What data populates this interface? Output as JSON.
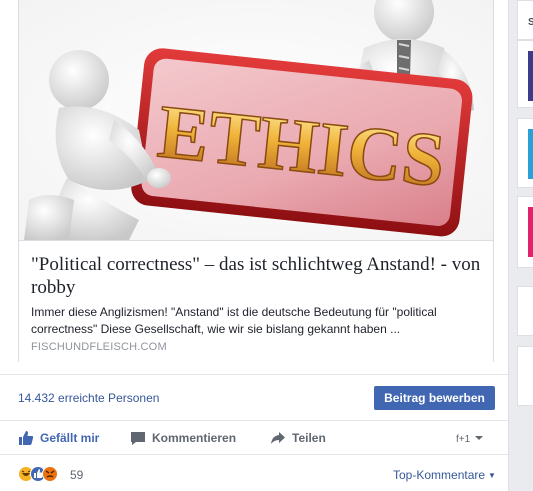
{
  "link": {
    "title": "\"Political correctness\" – das ist schlichtweg Anstand! - von robby",
    "description": "Immer diese Anglizismen! \"Anstand\" ist die deutsche Bedeutung für \"political correctness\" Diese Gesellschaft, wie wir sie bislang gekannt haben ...",
    "domain": "FISCHUNDFLEISCH.COM",
    "image_text": "ETHICS"
  },
  "insights": {
    "reach": "14.432 erreichte Personen",
    "boost_label": "Beitrag bewerben"
  },
  "actions": {
    "like": "Gefällt mir",
    "comment": "Kommentieren",
    "share": "Teilen"
  },
  "reactions": {
    "count": "59",
    "sort_label": "Top-Kommentare"
  },
  "colors": {
    "brand": "#4267b2",
    "link": "#365899",
    "muted": "#90949c"
  }
}
